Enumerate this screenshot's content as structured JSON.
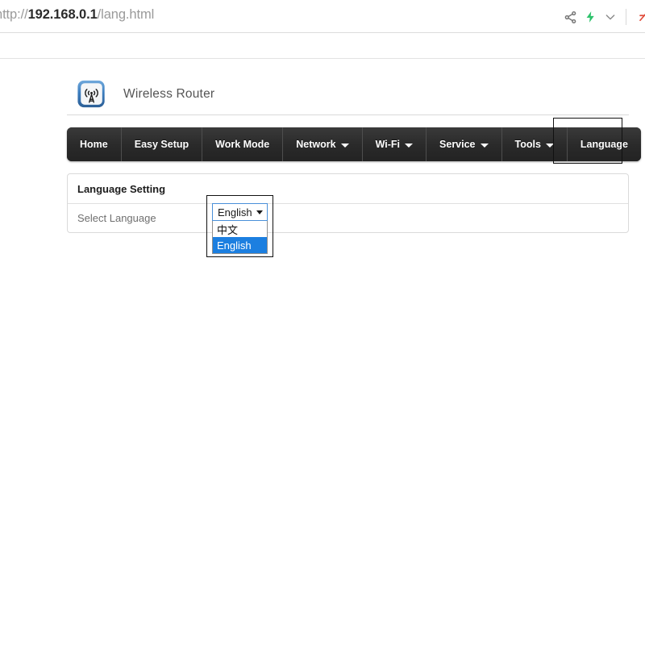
{
  "browser": {
    "url_scheme": "http://",
    "url_host": "192.168.0.1",
    "url_path": "/lang.html",
    "actions": [
      {
        "name": "share-icon",
        "label": "Share"
      },
      {
        "name": "lightning-icon",
        "label": "Turbo",
        "color": "#2dc26b"
      },
      {
        "name": "chevron-down-icon",
        "label": "More"
      }
    ]
  },
  "header": {
    "logo_name": "wireless-router-logo",
    "title": "Wireless Router"
  },
  "nav": {
    "items": [
      {
        "label": "Home",
        "caret": false
      },
      {
        "label": "Easy Setup",
        "caret": false
      },
      {
        "label": "Work Mode",
        "caret": false
      },
      {
        "label": "Network",
        "caret": true
      },
      {
        "label": "Wi-Fi",
        "caret": true
      },
      {
        "label": "Service",
        "caret": true
      },
      {
        "label": "Tools",
        "caret": true
      },
      {
        "label": "Language",
        "caret": false
      }
    ],
    "focused_item": "Language"
  },
  "panel": {
    "title": "Language Setting",
    "row_label": "Select Language",
    "select": {
      "value": "English",
      "expanded": true,
      "options": [
        {
          "label": "中文",
          "selected": false
        },
        {
          "label": "English",
          "selected": true
        }
      ]
    }
  },
  "colors": {
    "nav_background": "#2c2c2c",
    "select_border": "#4a90d9",
    "option_highlight": "#1c7fe0",
    "label_text": "#6f6f6f",
    "turbo_green": "#2dc26b"
  }
}
